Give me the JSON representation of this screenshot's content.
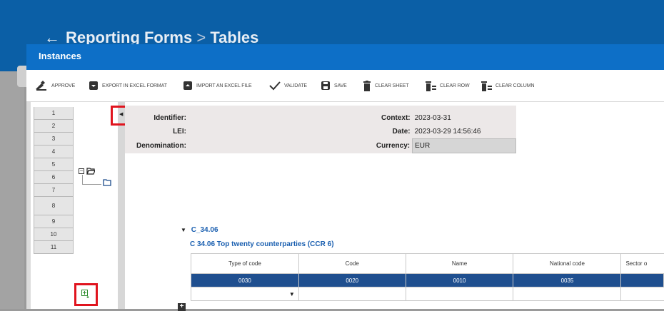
{
  "background": {
    "title_back": "←",
    "title_part1": "Reporting Forms",
    "title_sep": ">",
    "title_part2": "Tables"
  },
  "modal": {
    "title": "Instances"
  },
  "toolbar": {
    "approve": "APPROVE",
    "export": "EXPORT IN EXCEL FORMAT",
    "import": "IMPORT AN EXCEL FILE",
    "validate": "VALIDATE",
    "save": "SAVE",
    "clear_sheet": "CLEAR SHEET",
    "clear_row": "CLEAR ROW",
    "clear_column": "CLEAR COLUMN"
  },
  "row_numbers": [
    "1",
    "2",
    "3",
    "4",
    "5",
    "6",
    "7",
    "8",
    "9",
    "10",
    "11"
  ],
  "header_info": {
    "identifier_label": "Identifier:",
    "identifier_value": "",
    "lei_label": "LEI:",
    "lei_value": "",
    "denomination_label": "Denomination:",
    "denomination_value": "",
    "context_label": "Context:",
    "context_value": "2023-03-31",
    "date_label": "Date:",
    "date_value": "2023-03-29 14:56:46",
    "currency_label": "Currency:",
    "currency_value": "EUR"
  },
  "section": {
    "code": "C_34.06",
    "title": "C 34.06 Top twenty counterparties (CCR 6)"
  },
  "table": {
    "columns": [
      "Type of code",
      "Code",
      "Name",
      "National code",
      "Sector o"
    ],
    "codes": [
      "0030",
      "0020",
      "0010",
      "0035",
      ""
    ]
  },
  "colors": {
    "accent": "#0d6fc7",
    "header_row": "#1f4f8f",
    "highlight": "#e0141e"
  }
}
